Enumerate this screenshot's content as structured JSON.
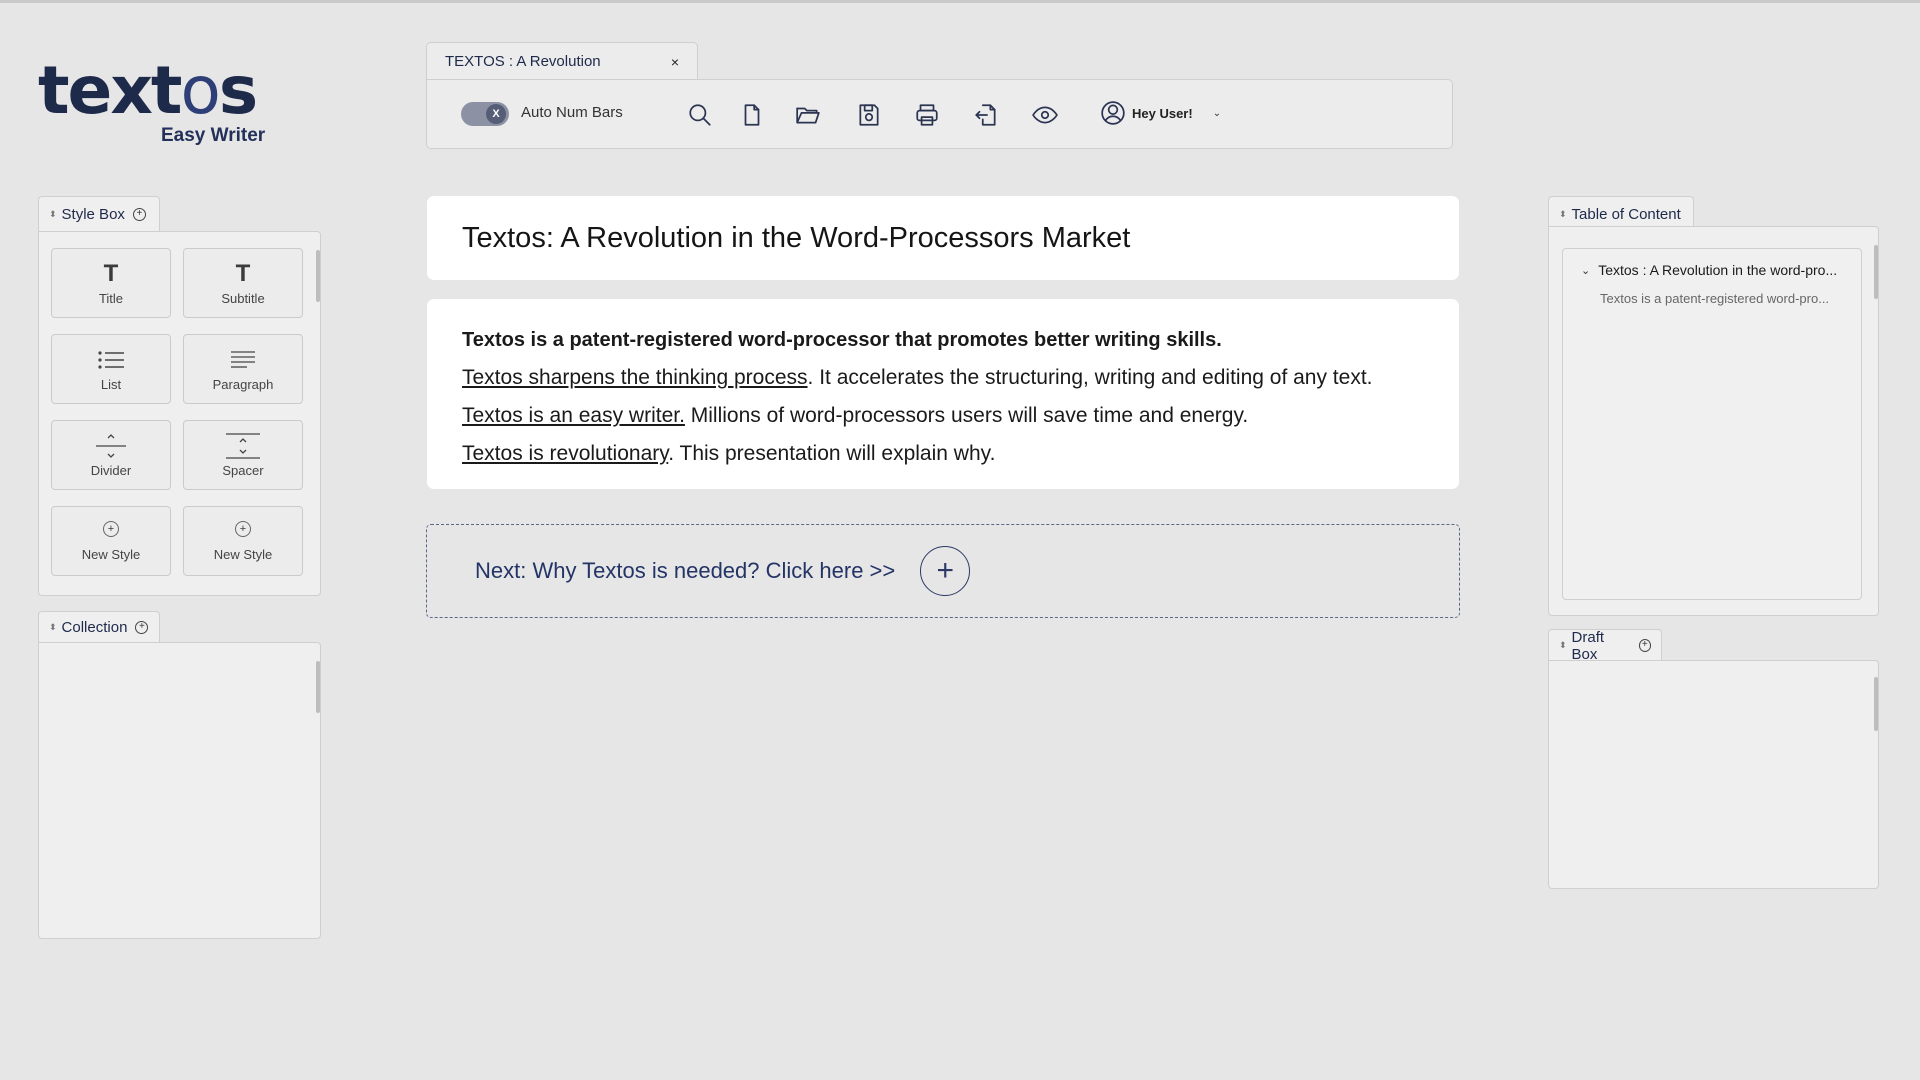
{
  "logo": {
    "word_start": "text",
    "word_o": "o",
    "word_end": "s",
    "tagline": "Easy Writer"
  },
  "document_tab": {
    "title": "TEXTOS : A Revolution",
    "close": "×"
  },
  "toolbar": {
    "toggle_knob": "X",
    "toggle_label": "Auto Num Bars",
    "icons": [
      "search-icon",
      "new-file-icon",
      "open-folder-icon",
      "save-icon",
      "print-icon",
      "export-icon",
      "preview-eye-icon"
    ],
    "user_label": "Hey User!",
    "user_chevron": "⌄"
  },
  "style_box": {
    "title": "Style Box",
    "tiles": [
      {
        "glyph": "T",
        "label": "Title"
      },
      {
        "glyph": "T",
        "label": "Subtitle"
      },
      {
        "label": "List"
      },
      {
        "label": "Paragraph"
      },
      {
        "label": "Divider"
      },
      {
        "label": "Spacer"
      },
      {
        "glyph": "+",
        "label": "New Style"
      },
      {
        "glyph": "+",
        "label": "New Style"
      }
    ]
  },
  "collection": {
    "title": "Collection"
  },
  "document": {
    "title": "Textos:  A Revolution in the Word-Processors Market",
    "line1": "Textos is a patent-registered word-processor that promotes better writing skills.",
    "line2_link": "Textos sharpens the thinking process",
    "line2_rest": ". It accelerates the structuring, writing and editing of any text.",
    "line3_link": "Textos is an easy writer.",
    "line3_rest": " Millions of word-processors users will save time and energy.",
    "line4_link": "Textos is revolutionary",
    "line4_rest": ". This presentation will explain why."
  },
  "next": {
    "label": "Next: Why Textos is needed? Click here >>",
    "plus": "+"
  },
  "toc": {
    "title": "Table of Content",
    "item": "Textos : A Revolution in the word-pro...",
    "sub": "Textos is a patent-registered word-pro...",
    "chevron": "⌄"
  },
  "draft_box": {
    "title": "Draft Box"
  },
  "colors": {
    "brand_navy": "#1e2a4a",
    "accent": "#2d3a66",
    "background": "#e6e6e6"
  }
}
